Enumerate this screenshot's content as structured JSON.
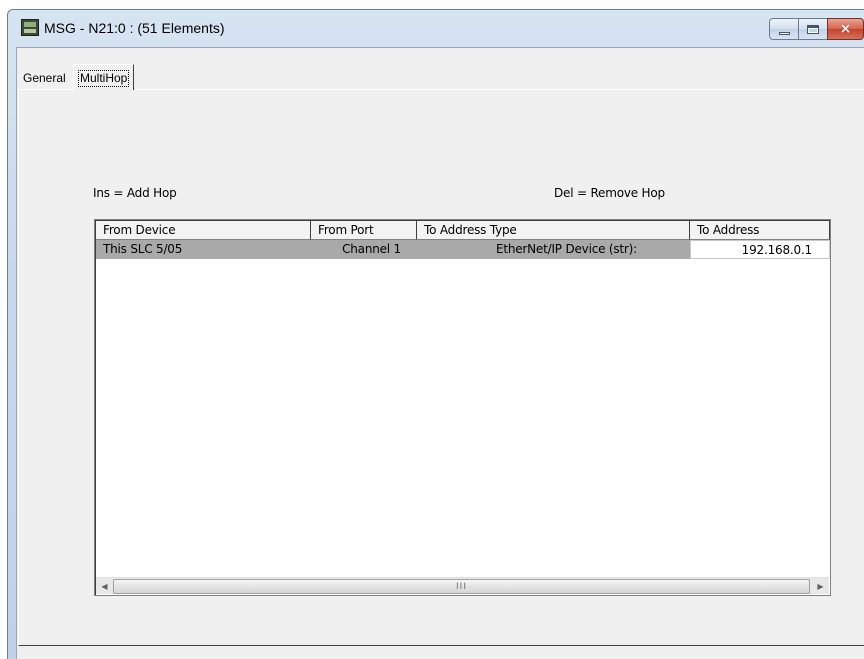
{
  "window": {
    "title": "MSG - N21:0 : (51 Elements)",
    "icon": "application-icon"
  },
  "caption_buttons": {
    "minimize": "minimize-icon",
    "maximize": "maximize-icon",
    "close": "×"
  },
  "tabs": [
    {
      "label": "General",
      "selected": false
    },
    {
      "label": "MultiHop",
      "selected": true
    }
  ],
  "hints": {
    "add": "Ins = Add Hop",
    "remove": "Del = Remove Hop"
  },
  "list": {
    "columns": [
      "From Device",
      "From Port",
      "To Address Type",
      "To Address"
    ],
    "rows": [
      {
        "from_device": "This SLC 5/05",
        "from_port": "Channel  1",
        "to_address_type": "EtherNet/IP Device (str):",
        "to_address": "192.168.0.1"
      }
    ]
  },
  "scrollbar": {
    "left_arrow": "◀",
    "right_arrow": "▶",
    "grip": "III"
  },
  "colors": {
    "selected_row": "#a9a9a9",
    "close_button": "#c3432b",
    "frame": "#c9d9ec"
  }
}
